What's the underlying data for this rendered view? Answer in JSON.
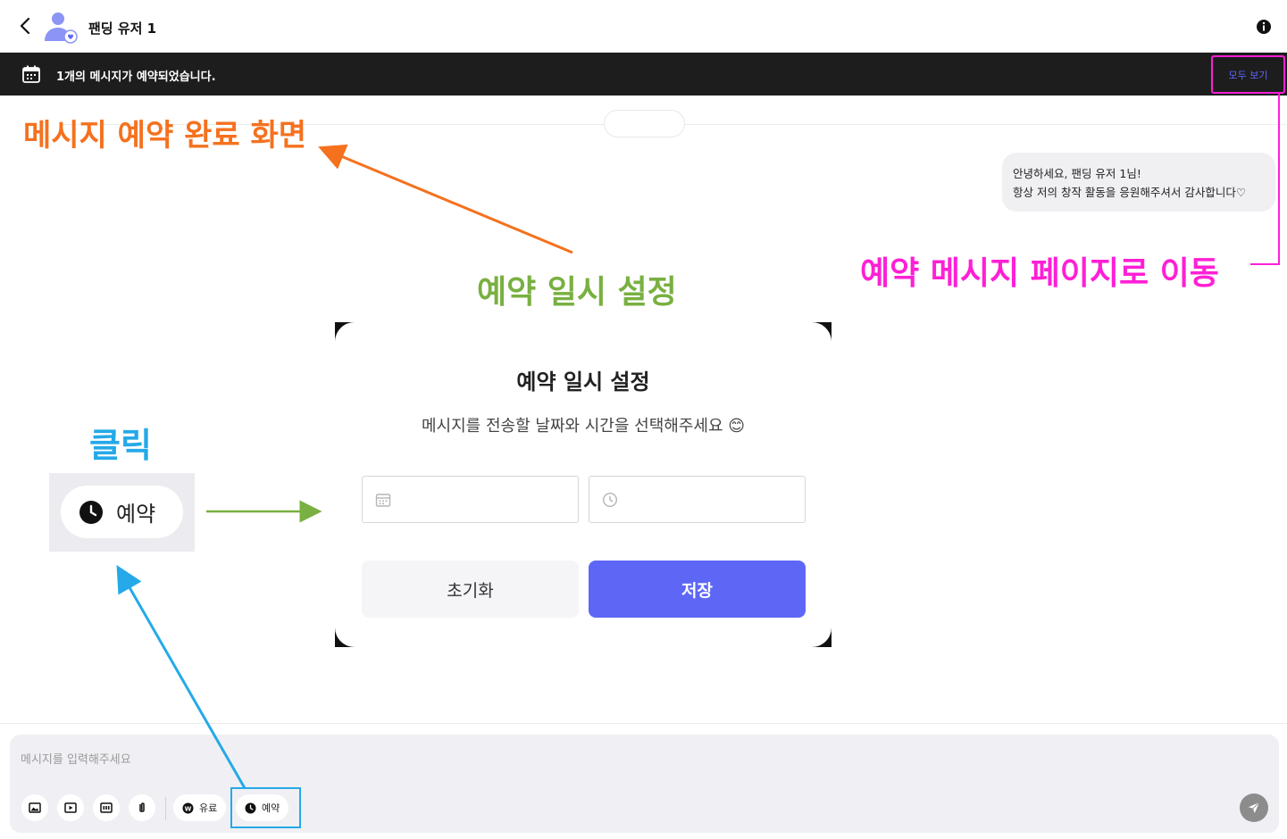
{
  "header": {
    "user_name": "팬딩 유저 1"
  },
  "notice": {
    "text": "1개의 메시지가 예약되었습니다.",
    "view_all_label": "모두 보기"
  },
  "chat": {
    "message_lines": [
      "안녕하세요, 팬딩 유저 1님!",
      "항상 저의 창작 활동을 응원해주셔서 감사합니다♡"
    ]
  },
  "annotations": {
    "complete_screen": "메시지 예약 완료 화면",
    "datetime_setting": "예약 일시 설정",
    "go_to_page": "예약 메시지 페이지로 이동",
    "click": "클릭"
  },
  "zoom": {
    "reserve_label": "예약"
  },
  "modal": {
    "title": "예약 일시 설정",
    "description": "메시지를 전송할 날짜와 시간을 선택해주세요",
    "description_emoji": "😊",
    "reset_label": "초기화",
    "save_label": "저장"
  },
  "composer": {
    "placeholder": "메시지를 입력해주세요",
    "paid_label": "유료",
    "reserve_label": "예약"
  },
  "colors": {
    "accent": "#5e67f5",
    "annotation_orange": "#f5711e",
    "annotation_green": "#79b041",
    "annotation_pink": "#ff1fd6",
    "annotation_blue": "#25a9e8"
  }
}
